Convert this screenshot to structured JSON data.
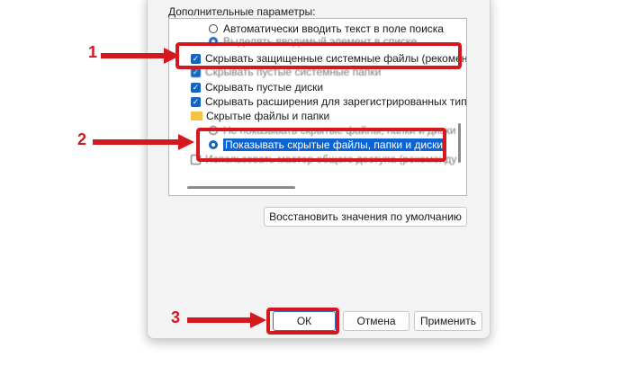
{
  "group_label": "Дополнительные параметры:",
  "list": {
    "row_auto_search": "Автоматически вводить текст в поле поиска",
    "row_select_item": "Выделять вводимый элемент в списке",
    "row_hide_protected": "Скрывать защищенные системные файлы (рекомен",
    "row_hide_hidden_partial": "Скрывать пустые системные папки",
    "row_hide_empty_drives": "Скрывать пустые диски",
    "row_hide_extensions": "Скрывать расширения для зарегистрированных типо",
    "folder_hidden": "Скрытые файлы и папки",
    "radio_dont_show": "Не показывать скрытые файлы, папки и диски",
    "radio_show": "Показывать скрытые файлы, папки и диски",
    "row_partial_last": "Использовать мастер общего доступа (рекоменду"
  },
  "buttons": {
    "restore": "Восстановить значения по умолчанию",
    "ok": "ОК",
    "cancel": "Отмена",
    "apply": "Применить"
  },
  "annotations": {
    "n1": "1",
    "n2": "2",
    "n3": "3"
  },
  "colors": {
    "accent": "#1564c0",
    "annotation_red": "#d4181f",
    "selection": "#0a64d6"
  }
}
